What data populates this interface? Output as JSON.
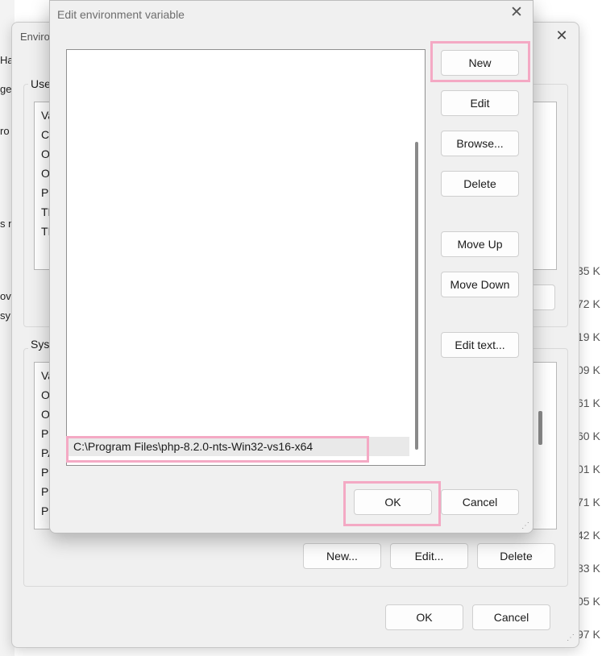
{
  "background": {
    "left_fragments": [
      "Ha",
      "ge",
      "ro",
      "s n",
      "ov",
      "sy"
    ],
    "sizes": [
      "35 K",
      "72 K",
      "19 K",
      "09 K",
      "61 K",
      "60 K",
      "01 K",
      "71 K",
      "42 K",
      "83 K",
      "05 K",
      "97 K"
    ]
  },
  "env_window": {
    "title": "Enviro",
    "user_group_label": "Use",
    "user_rows": [
      "Va",
      "Ch",
      "O",
      "O",
      "Pa",
      "TE",
      "TI"
    ],
    "system_group_label": "Syst",
    "system_rows": [
      "Va",
      "O",
      "O",
      "Pa",
      "PA",
      "PI",
      "PI",
      "PI"
    ],
    "system_buttons": {
      "new": "New...",
      "edit": "Edit...",
      "delete": "Delete"
    },
    "footer_buttons": {
      "ok": "OK",
      "cancel": "Cancel"
    }
  },
  "dialog": {
    "title": "Edit environment variable",
    "path_entries": [
      "C:\\Program Files\\php-8.2.0-nts-Win32-vs16-x64"
    ],
    "buttons": {
      "new": "New",
      "edit": "Edit",
      "browse": "Browse...",
      "delete": "Delete",
      "move_up": "Move Up",
      "move_down": "Move Down",
      "edit_text": "Edit text..."
    },
    "ok": "OK",
    "cancel": "Cancel"
  },
  "colors": {
    "highlight": "#f4a9c4",
    "dialog_bg": "#f0f0f0"
  }
}
